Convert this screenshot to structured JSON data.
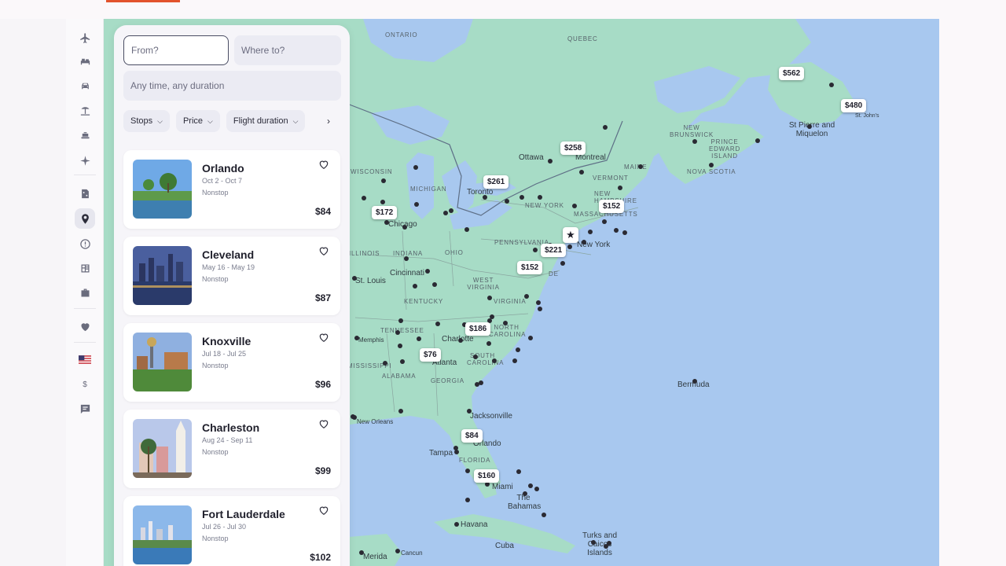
{
  "search": {
    "from_placeholder": "From?",
    "to_placeholder": "Where to?",
    "when_label": "Any time, any duration"
  },
  "filters": [
    {
      "label": "Stops"
    },
    {
      "label": "Price"
    },
    {
      "label": "Flight duration"
    }
  ],
  "results": [
    {
      "city": "Orlando",
      "dates": "Oct 2 - Oct 7",
      "stops": "Nonstop",
      "price": "$84"
    },
    {
      "city": "Cleveland",
      "dates": "May 16 - May 19",
      "stops": "Nonstop",
      "price": "$87"
    },
    {
      "city": "Knoxville",
      "dates": "Jul 18 - Jul 25",
      "stops": "Nonstop",
      "price": "$96"
    },
    {
      "city": "Charleston",
      "dates": "Aug 24 - Sep 11",
      "stops": "Nonstop",
      "price": "$99"
    },
    {
      "city": "Fort Lauderdale",
      "dates": "Jul 26 - Jul 30",
      "stops": "Nonstop",
      "price": "$102"
    }
  ],
  "rail": {
    "currency": "$"
  },
  "map": {
    "prices": [
      "$562",
      "$480",
      "$258",
      "$261",
      "$172",
      "$152",
      "$221",
      "$152",
      "$186",
      "$76",
      "$84",
      "$160"
    ],
    "regions": [
      "ONTARIO",
      "QUEBEC",
      "NEW BRUNSWICK",
      "PRINCE EDWARD ISLAND",
      "NOVA SCOTIA",
      "MAINE",
      "VERMONT",
      "NEW HAMPSHIRE",
      "MASSACHUSETTS",
      "NEW YORK",
      "MICHIGAN",
      "WISCONSIN",
      "PENNSYLVANIA",
      "OHIO",
      "INDIANA",
      "ILLINOIS",
      "WEST VIRGINIA",
      "VIRGINIA",
      "KENTUCKY",
      "TENNESSEE",
      "NORTH CAROLINA",
      "SOUTH CAROLINA",
      "GEORGIA",
      "ALABAMA",
      "MISSISSIPPI",
      "FLORIDA",
      "DE"
    ],
    "cities": [
      "St Pierre and Miquelon",
      "St. John's",
      "Ottawa",
      "Montreal",
      "Toronto",
      "Chicago",
      "New York",
      "St. Louis",
      "Cincinnati",
      "Memphis",
      "Charlotte",
      "Atlanta",
      "Jacksonville",
      "New Orleans",
      "Tampa",
      "Orlando",
      "Miami",
      "The Bahamas",
      "Havana",
      "Cuba",
      "Turks and Caicos Islands",
      "Bermuda",
      "Merida",
      "Cancun"
    ]
  }
}
